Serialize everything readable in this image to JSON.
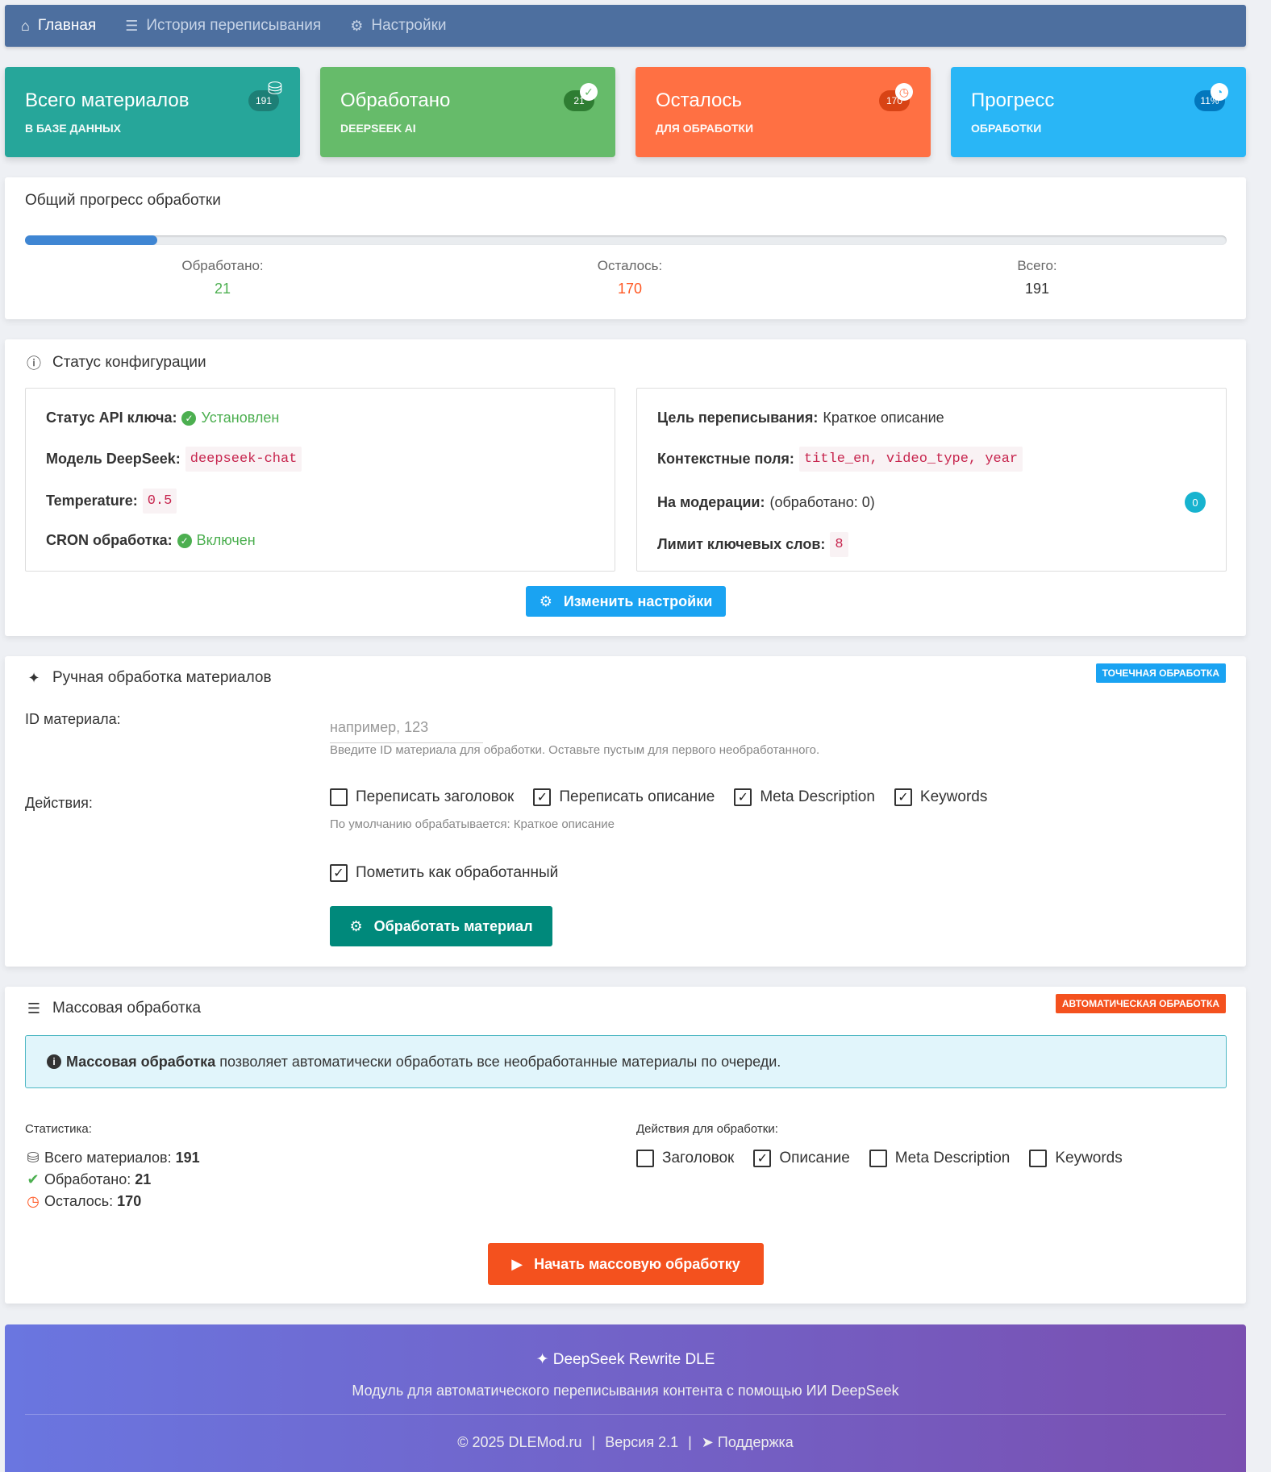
{
  "nav": {
    "items": [
      {
        "label": "Главная",
        "icon": "home-icon",
        "active": true
      },
      {
        "label": "История переписывания",
        "icon": "list-icon",
        "active": false
      },
      {
        "label": "Настройки",
        "icon": "gears-icon",
        "active": false
      }
    ]
  },
  "cards": [
    {
      "title": "Всего материалов",
      "sub": "В БАЗЕ ДАННЫХ",
      "badge": "191",
      "color": "#26a69a",
      "icon": "database-icon"
    },
    {
      "title": "Обработано",
      "sub": "DEEPSEEK AI",
      "badge": "21",
      "color": "#66bb6a",
      "icon": "check-icon"
    },
    {
      "title": "Осталось",
      "sub": "ДЛЯ ОБРАБОТКИ",
      "badge": "170",
      "color": "#ff7043",
      "icon": "clock-icon"
    },
    {
      "title": "Прогресс",
      "sub": "ОБРАБОТКИ",
      "badge": "11%",
      "color": "#29b6f6",
      "icon": "pie-icon"
    }
  ],
  "progress": {
    "title": "Общий прогресс обработки",
    "fraction": 0.11,
    "processed_label": "Обработано:",
    "processed_value": "21",
    "remaining_label": "Осталось:",
    "remaining_value": "170",
    "total_label": "Всего:",
    "total_value": "191"
  },
  "config": {
    "title": "Статус конфигурации",
    "api_key_label": "Статус API ключа:",
    "api_key_value": "Установлен",
    "model_label": "Модель DeepSeek:",
    "model_value": "deepseek-chat",
    "temperature_label": "Temperature:",
    "temperature_value": "0.5",
    "cron_label": "CRON обработка:",
    "cron_value": "Включен",
    "goal_label": "Цель переписывания:",
    "goal_value": "Краткое описание",
    "context_label": "Контекстные поля:",
    "context_value": "title_en, video_type, year",
    "moderation_label": "На модерации:",
    "moderation_value": "(обработано: 0)",
    "moderation_badge": "0",
    "keywords_limit_label": "Лимит ключевых слов:",
    "keywords_limit_value": "8",
    "button": "Изменить настройки"
  },
  "manual": {
    "title": "Ручная обработка материалов",
    "badge": "ТОЧЕЧНАЯ ОБРАБОТКА",
    "id_label": "ID материала:",
    "id_placeholder": "например, 123",
    "id_help": "Введите ID материала для обработки. Оставьте пустым для первого необработанного.",
    "actions_label": "Действия:",
    "actions": [
      {
        "label": "Переписать заголовок",
        "checked": false
      },
      {
        "label": "Переписать описание",
        "checked": true
      },
      {
        "label": "Meta Description",
        "checked": true
      },
      {
        "label": "Keywords",
        "checked": true
      }
    ],
    "actions_help": "По умолчанию обрабатывается: Краткое описание",
    "mark_label": "Пометить как обработанный",
    "mark_checked": true,
    "button": "Обработать материал"
  },
  "mass": {
    "title": "Массовая обработка",
    "badge": "АВТОМАТИЧЕСКАЯ ОБРАБОТКА",
    "info_bold": "Массовая обработка",
    "info_text": "позволяет автоматически обработать все необработанные материалы по очереди.",
    "stats_label": "Статистика:",
    "stat_total_label": "Всего материалов:",
    "stat_total_value": "191",
    "stat_done_label": "Обработано:",
    "stat_done_value": "21",
    "stat_left_label": "Осталось:",
    "stat_left_value": "170",
    "actions_label": "Действия для обработки:",
    "actions": [
      {
        "label": "Заголовок",
        "checked": false
      },
      {
        "label": "Описание",
        "checked": true
      },
      {
        "label": "Meta Description",
        "checked": false
      },
      {
        "label": "Keywords",
        "checked": false
      }
    ],
    "button": "Начать массовую обработку"
  },
  "footer": {
    "title": "DeepSeek Rewrite DLE",
    "subtitle": "Модуль для автоматического переписывания контента с помощью ИИ DeepSeek",
    "copyright": "© 2025 DLEMod.ru",
    "version": "Версия 2.1",
    "support": "Поддержка"
  }
}
